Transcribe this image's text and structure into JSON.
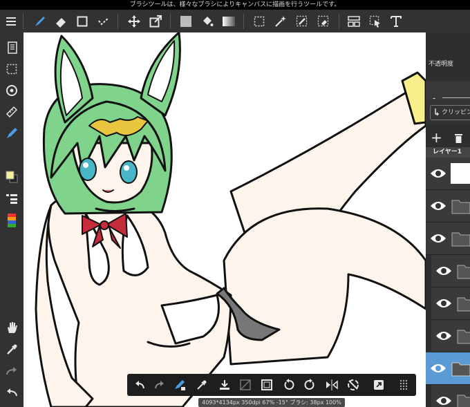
{
  "tooltip": "ブラシツールは、様々なブラシによりキャンバスに描画を行うツールです。",
  "right_panel": {
    "opacity_label": "不透明度",
    "opacity_minus": "-",
    "clipping_label": "クリッピング",
    "layer_header": "レイヤー1",
    "add_label": "+"
  },
  "status_bar": "4093*4134px 350dpi 67% -15° ブラシ: 38px 100%",
  "colors": {
    "accent": "#4a9ee8",
    "selected_layer": "#5b9bd5"
  },
  "icons": {
    "top": [
      "menu-icon",
      "brush-icon",
      "eraser-icon",
      "rect-shape-icon",
      "select-check-icon",
      "move-icon",
      "transform-icon",
      "fill-color-icon",
      "bucket-icon",
      "gradient-icon",
      "selection-rect-icon",
      "magic-wand-icon",
      "select-pen-icon",
      "select-eraser-icon",
      "panel-layout-icon",
      "cursor-icon",
      "text-tool-icon"
    ],
    "left": [
      "pages-icon",
      "selection-icon",
      "rotate-icon",
      "ruler-icon",
      "brush-icon",
      "color-swatch-icon",
      "layers-list-icon",
      "palette-icon",
      "hand-icon",
      "eyedropper-icon",
      "redo-icon",
      "undo-icon"
    ],
    "bottom": [
      "undo-icon",
      "redo-icon",
      "brush-eraser-icon",
      "eyedropper-icon",
      "import-icon",
      "deselect-icon",
      "select-all-icon",
      "rotate-left-icon",
      "rotate-right-icon",
      "flip-icon",
      "reset-rotate-icon",
      "external-icon",
      "grid-icon"
    ]
  }
}
